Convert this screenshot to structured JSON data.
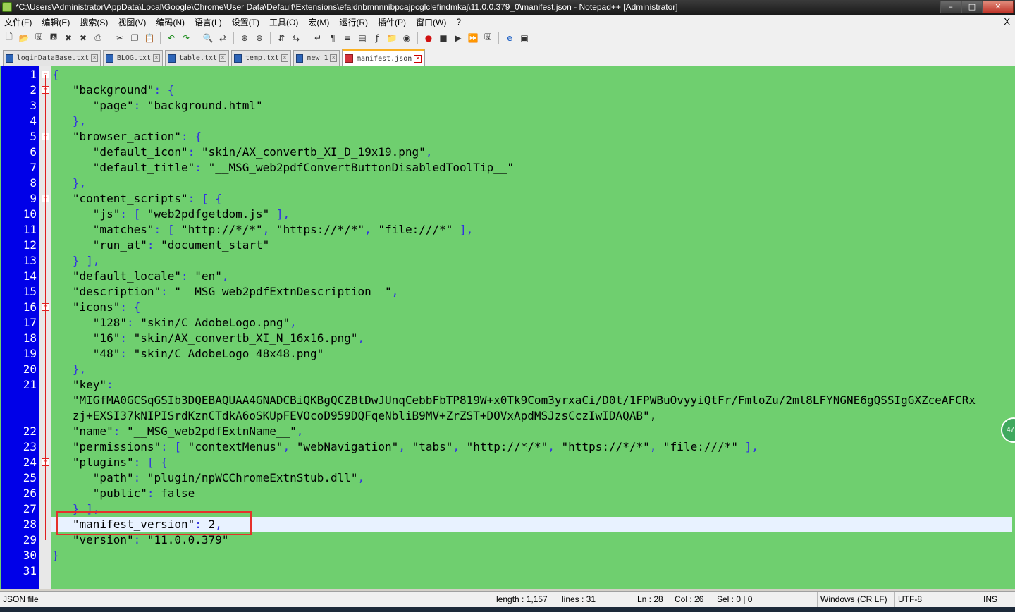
{
  "window": {
    "title": "*C:\\Users\\Administrator\\AppData\\Local\\Google\\Chrome\\User Data\\Default\\Extensions\\efaidnbmnnnibpcajpcglclefindmkaj\\11.0.0.379_0\\manifest.json - Notepad++ [Administrator]",
    "minimize": "–",
    "maximize": "□",
    "close": "✕"
  },
  "menu": {
    "items": [
      "文件(F)",
      "编辑(E)",
      "搜索(S)",
      "视图(V)",
      "编码(N)",
      "语言(L)",
      "设置(T)",
      "工具(O)",
      "宏(M)",
      "运行(R)",
      "插件(P)",
      "窗口(W)",
      "?"
    ],
    "close_label": "X"
  },
  "toolbar": {
    "icons": [
      "new-file-icon",
      "open-file-icon",
      "save-icon",
      "save-all-icon",
      "close-icon",
      "close-all-icon",
      "print-icon",
      "cut-icon",
      "copy-icon",
      "paste-icon",
      "undo-icon",
      "redo-icon",
      "find-icon",
      "replace-icon",
      "zoom-in-icon",
      "zoom-out-icon",
      "sync-v-icon",
      "sync-h-icon",
      "word-wrap-icon",
      "show-all-chars-icon",
      "indent-guide-icon",
      "doc-map-icon",
      "function-list-icon",
      "folder-icon",
      "eye-icon",
      "record-macro-icon",
      "stop-macro-icon",
      "play-macro-icon",
      "run-macro-icon",
      "save-macro-icon",
      "browser-icon",
      "launch-icon"
    ]
  },
  "tabs": [
    {
      "label": "loginDataBase.txt",
      "active": false
    },
    {
      "label": "BLOG.txt",
      "active": false
    },
    {
      "label": "table.txt",
      "active": false
    },
    {
      "label": "temp.txt",
      "active": false
    },
    {
      "label": "new 1",
      "active": false
    },
    {
      "label": "manifest.json",
      "active": true
    }
  ],
  "editor": {
    "line_numbers": [
      "1",
      "2",
      "3",
      "4",
      "5",
      "6",
      "7",
      "8",
      "9",
      "10",
      "11",
      "12",
      "13",
      "14",
      "15",
      "16",
      "17",
      "18",
      "19",
      "20",
      "21",
      "22",
      "23",
      "24",
      "25",
      "26",
      "27",
      "28",
      "29",
      "30",
      "31"
    ],
    "lines": [
      "{",
      "   \"background\": {",
      "      \"page\": \"background.html\"",
      "   },",
      "   \"browser_action\": {",
      "      \"default_icon\": \"skin/AX_convertb_XI_D_19x19.png\",",
      "      \"default_title\": \"__MSG_web2pdfConvertButtonDisabledToolTip__\"",
      "   },",
      "   \"content_scripts\": [ {",
      "      \"js\": [ \"web2pdfgetdom.js\" ],",
      "      \"matches\": [ \"http://*/*\", \"https://*/*\", \"file:///*\" ],",
      "      \"run_at\": \"document_start\"",
      "   } ],",
      "   \"default_locale\": \"en\",",
      "   \"description\": \"__MSG_web2pdfExtnDescription__\",",
      "   \"icons\": {",
      "      \"128\": \"skin/C_AdobeLogo.png\",",
      "      \"16\": \"skin/AX_convertb_XI_N_16x16.png\",",
      "      \"48\": \"skin/C_AdobeLogo_48x48.png\"",
      "   },",
      "   \"key\":",
      "   \"MIGfMA0GCSqGSIb3DQEBAQUAA4GNADCBiQKBgQCZBtDwJUnqCebbFbTP819W+x0Tk9Com3yrxaCi/D0t/1FPWBuOvyyiQtFr/FmloZu/2ml8LFYNGNE6gQSSIgGXZceAFCRx",
      "   zj+EXSI37kNIPISrdKznCTdkA6oSKUpFEVOcoD959DQFqeNbliB9MV+ZrZST+DOVxApdMSJzsCczIwIDAQAB\",",
      "   \"name\": \"__MSG_web2pdfExtnName__\",",
      "   \"permissions\": [ \"contextMenus\", \"webNavigation\", \"tabs\", \"http://*/*\", \"https://*/*\", \"file:///*\" ],",
      "   \"plugins\": [ {",
      "      \"path\": \"plugin/npWCChromeExtnStub.dll\",",
      "      \"public\": false",
      "   } ],",
      "   \"manifest_version\": 2,",
      "   \"version\": \"11.0.0.379\"",
      "}",
      ""
    ],
    "scroll_badge": "47",
    "current_line": 28,
    "highlighted_line": 28
  },
  "status": {
    "file_type": "JSON file",
    "length": "length : 1,157",
    "lines": "lines : 31",
    "ln": "Ln : 28",
    "col": "Col : 26",
    "sel": "Sel : 0 | 0",
    "eol": "Windows (CR LF)",
    "encoding": "UTF-8",
    "mode": "INS"
  },
  "colors": {
    "editor_bg": "#6fcf6f",
    "gutter_bg": "#0000e8",
    "highlight_box": "#e5312b",
    "active_tab_accent": "#fab022"
  }
}
